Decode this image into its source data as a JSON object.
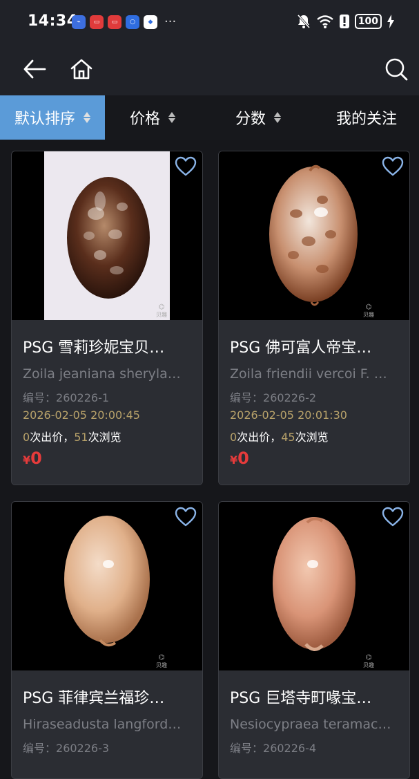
{
  "status_bar": {
    "time": "14:34",
    "notification_icons": [
      "usb-icon",
      "huawei-app-icon",
      "huawei-app-icon",
      "lightbulb-icon",
      "shield-icon"
    ],
    "more": "···",
    "battery": "100"
  },
  "app_bar": {
    "icons": [
      "back-arrow-icon",
      "home-icon",
      "search-icon"
    ]
  },
  "filters": [
    {
      "label": "默认排序",
      "active": true,
      "sortable": true
    },
    {
      "label": "价格",
      "active": false,
      "sortable": true
    },
    {
      "label": "分数",
      "active": false,
      "sortable": true
    },
    {
      "label": "我的关注",
      "active": false,
      "sortable": false
    }
  ],
  "products": [
    {
      "title": "PSG 雪莉珍妮宝贝…",
      "latin": "Zoila jeaniana sheryla…",
      "code_label": "编号：",
      "code": "260226-1",
      "date": "2026-02-05 20:00:45",
      "bids": "0",
      "bids_label": "次出价，",
      "views": "51",
      "views_label": "次浏览",
      "price_symbol": "¥",
      "price": "0",
      "watermark": "贝趣",
      "image_bg": "light"
    },
    {
      "title": "PSG 佛可富人帝宝…",
      "latin": "Zoila friendii vercoi F. …",
      "code_label": "编号：",
      "code": "260226-2",
      "date": "2026-02-05 20:01:30",
      "bids": "0",
      "bids_label": "次出价，",
      "views": "45",
      "views_label": "次浏览",
      "price_symbol": "¥",
      "price": "0",
      "watermark": "贝趣",
      "image_bg": "dark"
    },
    {
      "title": "PSG 菲律宾兰福珍…",
      "latin": "Hiraseadusta langford…",
      "code_label": "编号：",
      "code": "260226-3",
      "watermark": "贝趣",
      "image_bg": "dark"
    },
    {
      "title": "PSG 巨塔寺町喙宝…",
      "latin": "Nesiocypraea teramac…",
      "code_label": "编号：",
      "code": "260226-4",
      "watermark": "贝趣",
      "image_bg": "dark"
    }
  ],
  "colors": {
    "accent": "#5b9bd8",
    "price": "#e63b3b",
    "highlight": "#b8a26a",
    "heart": "#8ab4e8"
  }
}
